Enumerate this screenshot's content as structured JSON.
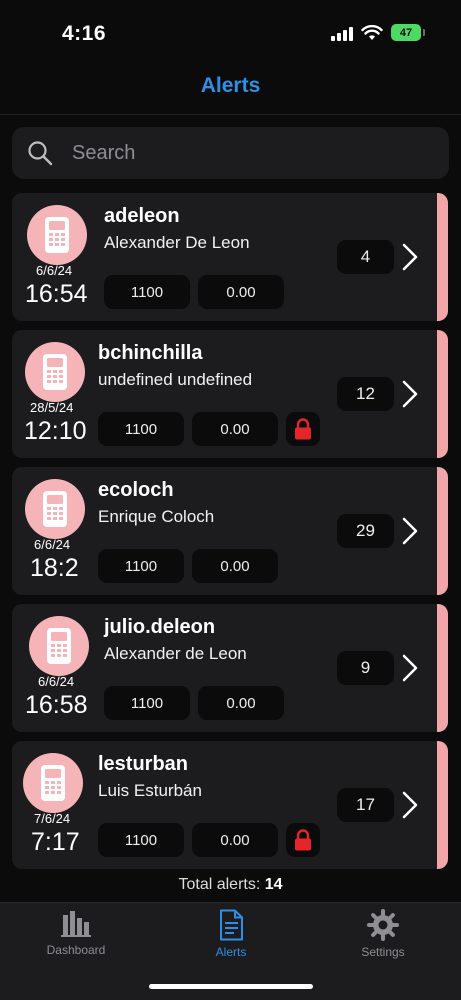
{
  "status_bar": {
    "time": "4:16",
    "battery": "47"
  },
  "nav": {
    "title": "Alerts"
  },
  "search": {
    "placeholder": "Search"
  },
  "alerts": [
    {
      "username": "adeleon",
      "full_name": "Alexander De Leon",
      "date": "6/6/24",
      "time": "16:54",
      "code": "1100",
      "amount": "0.00",
      "count": "4",
      "locked": false
    },
    {
      "username": "bchinchilla",
      "full_name": "undefined undefined",
      "date": "28/5/24",
      "time": "12:10",
      "code": "1100",
      "amount": "0.00",
      "count": "12",
      "locked": true
    },
    {
      "username": "ecoloch",
      "full_name": "Enrique Coloch",
      "date": "6/6/24",
      "time": "18:2",
      "code": "1100",
      "amount": "0.00",
      "count": "29",
      "locked": false
    },
    {
      "username": "julio.deleon",
      "full_name": "Alexander de Leon",
      "date": "6/6/24",
      "time": "16:58",
      "code": "1100",
      "amount": "0.00",
      "count": "9",
      "locked": false
    },
    {
      "username": "lesturban",
      "full_name": "Luis Esturbán",
      "date": "7/6/24",
      "time": "7:17",
      "code": "1100",
      "amount": "0.00",
      "count": "17",
      "locked": true
    }
  ],
  "footer": {
    "total_label": "Total alerts:",
    "total_value": "14"
  },
  "tabs": [
    {
      "label": "Dashboard",
      "icon": "bar-chart-icon",
      "active": false
    },
    {
      "label": "Alerts",
      "icon": "document-icon",
      "active": true
    },
    {
      "label": "Settings",
      "icon": "gear-icon",
      "active": false
    }
  ],
  "colors": {
    "accent": "#2e8fe6",
    "stripe": "#f2a6aa",
    "avatar": "#f5b4b7",
    "lock": "#e5242b"
  }
}
